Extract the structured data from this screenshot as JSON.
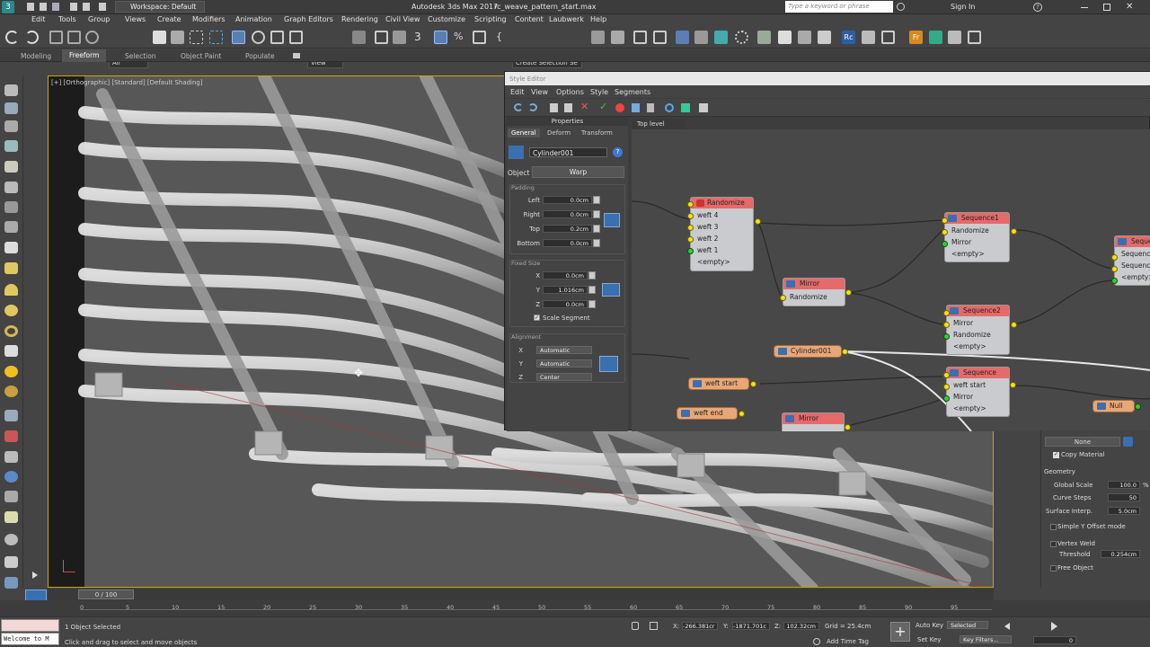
{
  "titlebar": {
    "workspace": "Workspace: Default",
    "app_title": "Autodesk 3ds Max 2017",
    "file_name": "rc_weave_pattern_start.max",
    "search_placeholder": "Type a keyword or phrase",
    "sign_in": "Sign In"
  },
  "menubar": [
    "Edit",
    "Tools",
    "Group",
    "Views",
    "Create",
    "Modifiers",
    "Animation",
    "Graph Editors",
    "Rendering",
    "Civil View",
    "Customize",
    "Scripting",
    "Content",
    "Laubwerk",
    "Help"
  ],
  "toolbar": {
    "filter_value": "All",
    "view_value": "View",
    "selection_set_placeholder": "Create Selection Se"
  },
  "ribbon": {
    "tabs": [
      "Modeling",
      "Freeform",
      "Selection",
      "Object Paint",
      "Populate"
    ],
    "active_tab": "Freeform"
  },
  "viewport": {
    "label": "[+] [Orthographic] [Standard] [Default Shading]"
  },
  "style_editor": {
    "title": "Style Editor",
    "menu": [
      "Edit",
      "View",
      "Options",
      "Style",
      "Segments"
    ],
    "properties_header": "Properties",
    "tabs": [
      "General",
      "Deform",
      "Transform"
    ],
    "active_tab": "General",
    "object_name": "Cylinder001",
    "object_label": "Object",
    "object_value": "Warp",
    "padding": {
      "label": "Padding",
      "left_label": "Left",
      "left": "0.0cm",
      "right_label": "Right",
      "right": "0.0cm",
      "top_label": "Top",
      "top": "0.2cm",
      "bottom_label": "Bottom",
      "bottom": "0.0cm"
    },
    "fixed_size": {
      "label": "Fixed Size",
      "x_label": "X",
      "x": "0.0cm",
      "y_label": "Y",
      "y": "1.016cm",
      "z_label": "Z",
      "z": "0.0cm",
      "scale_segment": "Scale Segment"
    },
    "alignment": {
      "label": "Alignment",
      "x_label": "X",
      "x": "Automatic",
      "y_label": "Y",
      "y": "Automatic",
      "z_label": "Z",
      "z": "Center"
    },
    "graph_tab": "Top level",
    "nodes": {
      "randomize": {
        "title": "Randomize",
        "rows": [
          "weft 4",
          "weft 3",
          "weft 2",
          "weft 1",
          "<empty>"
        ]
      },
      "sequence1": {
        "title": "Sequence1",
        "rows": [
          "Randomize",
          "Mirror",
          "<empty>"
        ]
      },
      "sequence_r": {
        "title": "Sequen",
        "rows": [
          "Sequence",
          "Sequence",
          "<empty>"
        ]
      },
      "mirror1": {
        "title": "Mirror",
        "rows": [
          "Randomize"
        ]
      },
      "sequence2": {
        "title": "Sequence2",
        "rows": [
          "Mirror",
          "Randomize",
          "<empty>"
        ]
      },
      "sequence": {
        "title": "Sequence",
        "rows": [
          "weft start",
          "Mirror",
          "<empty>"
        ]
      },
      "mirror2": {
        "title": "Mirror",
        "rows": []
      },
      "cylinder": "Cylinder001",
      "weft_start": "weft start",
      "weft_end": "weft end",
      "null": "Null"
    }
  },
  "right_panel": {
    "none": "None",
    "copy_material": "Copy Material",
    "geometry": "Geometry",
    "global_scale_label": "Global Scale",
    "global_scale": "100.0",
    "curve_steps_label": "Curve Steps",
    "curve_steps": "50",
    "surface_interp_label": "Surface Interp.",
    "surface_interp": "5.0cm",
    "simple_y": "Simple Y Offset mode",
    "vertex_weld": "Vertex Weld",
    "threshold_label": "Threshold",
    "threshold": "0.254cm",
    "free_object": "Free Object"
  },
  "timeline": {
    "frame": "0 / 100",
    "ticks": [
      "0",
      "5",
      "10",
      "15",
      "20",
      "25",
      "30",
      "35",
      "40",
      "45",
      "50",
      "55",
      "60",
      "65",
      "70",
      "75",
      "80",
      "85",
      "90",
      "95"
    ]
  },
  "status": {
    "maxscript": "Welcome to M",
    "selected": "1 Object Selected",
    "prompt": "Click and drag to select and move objects",
    "x_label": "X:",
    "x": "-266.381cr",
    "y_label": "Y:",
    "y": "-1871.701c",
    "z_label": "Z:",
    "z": "102.32cm",
    "grid": "Grid = 25.4cm",
    "add_time_tag": "Add Time Tag",
    "auto_key": "Auto Key",
    "selected_dd": "Selected",
    "set_key": "Set Key",
    "key_filters": "Key Filters...",
    "frame_field": "0"
  }
}
